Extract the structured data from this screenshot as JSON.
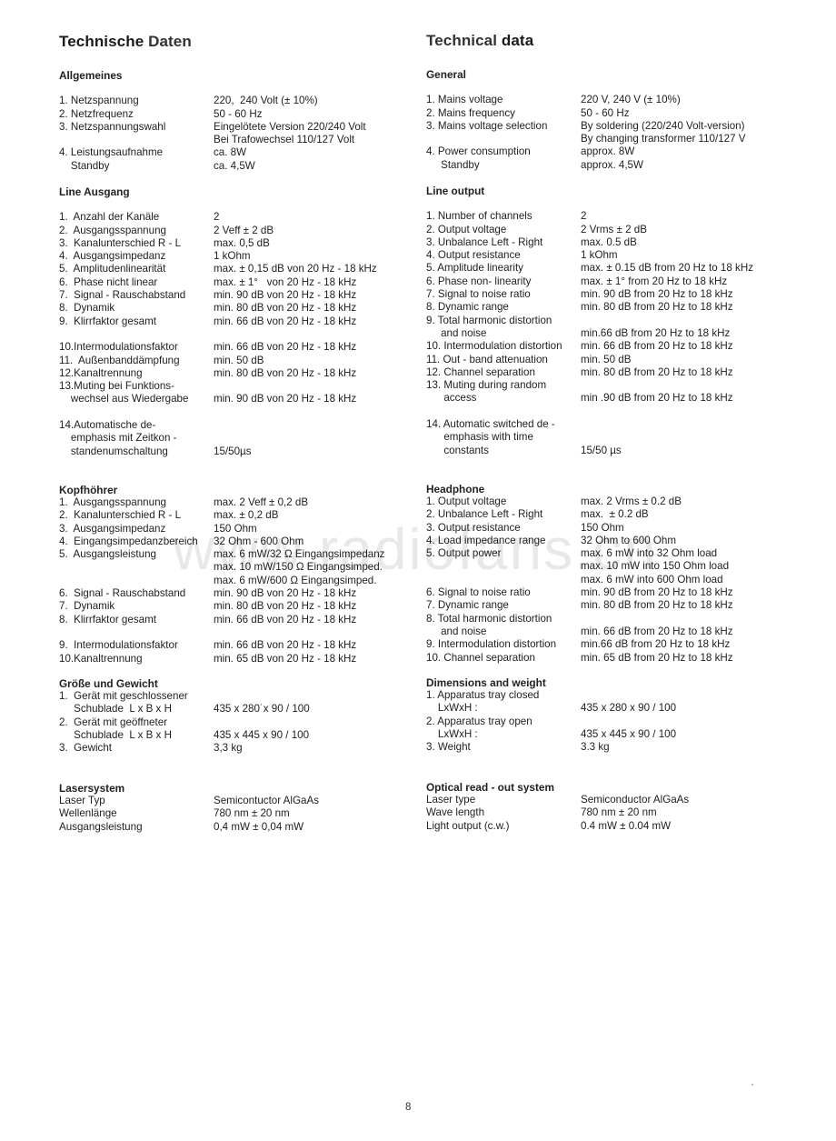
{
  "watermark": "www.radiofans.cn",
  "page_number": "8",
  "german": {
    "title_a": "Technische ",
    "title_b": "Daten",
    "general": {
      "title": "Allgemeines",
      "rows": [
        {
          "label": "1. Netzspannung",
          "value": "220,  240 Volt (± 10%)"
        },
        {
          "label": "2. Netzfrequenz",
          "value": "50 - 60 Hz"
        },
        {
          "label": "3. Netzspannungswahl",
          "value": "Eingelötete Version 220/240 Volt"
        },
        {
          "label": "",
          "value": "Bei Trafowechsel 110/127 Volt"
        },
        {
          "label": "4. Leistungsaufnahme",
          "value": "ca. 8W"
        },
        {
          "label": "    Standby",
          "value": "ca. 4,5W"
        }
      ]
    },
    "line": {
      "title": "Line Ausgang",
      "rows": [
        {
          "label": "1.  Anzahl der Kanäle",
          "value": "2"
        },
        {
          "label": "2.  Ausgangsspannung",
          "value": "2 Veff ± 2 dB"
        },
        {
          "label": "3.  Kanalunterschied R - L",
          "value": "max. 0,5 dB"
        },
        {
          "label": "4.  Ausgangsimpedanz",
          "value": "1 kOhm"
        },
        {
          "label": "5.  Amplitudenlinearität",
          "value": "max. ± 0,15 dB von 20 Hz - 18 kHz"
        },
        {
          "label": "6.  Phase nicht linear",
          "value": "max. ± 1°   von 20 Hz - 18 kHz"
        },
        {
          "label": "7.  Signal - Rauschabstand",
          "value": "min. 90 dB von 20 Hz - 18 kHz"
        },
        {
          "label": "8.  Dynamik",
          "value": "min. 80 dB von 20 Hz - 18 kHz"
        },
        {
          "label": "9.  Klirrfaktor gesamt",
          "value": "min. 66 dB von 20 Hz - 18 kHz"
        },
        {
          "label": "",
          "value": ""
        },
        {
          "label": "10.Intermodulationsfaktor",
          "value": "min. 66 dB von 20 Hz - 18 kHz"
        },
        {
          "label": "11.  Außenbanddämpfung",
          "value": "min. 50 dB"
        },
        {
          "label": "12.Kanaltrennung",
          "value": "min. 80 dB von 20 Hz - 18 kHz"
        },
        {
          "label": "13.Muting bei Funktions-",
          "value": ""
        },
        {
          "label": "    wechsel aus Wiedergabe",
          "value": "min. 90 dB von 20 Hz - 18 kHz"
        },
        {
          "label": "",
          "value": ""
        },
        {
          "label": "14.Automatische de-",
          "value": ""
        },
        {
          "label": "    emphasis mit Zeitkon -",
          "value": ""
        },
        {
          "label": "    standenumschaltung",
          "value": "15/50µs"
        }
      ]
    },
    "headphone": {
      "title": "Kopfhöhrer",
      "rows": [
        {
          "label": "1.  Ausgangsspannung",
          "value": "max. 2 Veff ± 0,2 dB"
        },
        {
          "label": "2.  Kanalunterschied R - L",
          "value": "max. ± 0,2 dB"
        },
        {
          "label": "3.  Ausgangsimpedanz",
          "value": "150 Ohm"
        },
        {
          "label": "4.  Eingangsimpedanzbereich",
          "value": "32 Ohm - 600 Ohm"
        },
        {
          "label": "5.  Ausgangsleistung",
          "value": "max. 6 mW/32 Ω Eingangsimpedanz"
        },
        {
          "label": "",
          "value": "max. 10 mW/150 Ω Eingangsimped."
        },
        {
          "label": "",
          "value": "max. 6 mW/600 Ω Eingangsimped."
        },
        {
          "label": "6.  Signal - Rauschabstand",
          "value": "min. 90 dB von 20 Hz - 18 kHz"
        },
        {
          "label": "7.  Dynamik",
          "value": "min. 80 dB von 20 Hz - 18 kHz"
        },
        {
          "label": "8.  Klirrfaktor gesamt",
          "value": "min. 66 dB von 20 Hz - 18 kHz"
        },
        {
          "label": "",
          "value": ""
        },
        {
          "label": "9.  Intermodulationsfaktor",
          "value": "min. 66 dB von 20 Hz - 18 kHz"
        },
        {
          "label": "10.Kanaltrennung",
          "value": "min. 65 dB von 20 Hz - 18 kHz"
        }
      ]
    },
    "dimensions": {
      "title": "Größe und Gewicht",
      "rows": [
        {
          "label": "1.  Gerät mit geschlossener",
          "value": ""
        },
        {
          "label": "     Schublade  L x B x H",
          "value": "435 x 280˙x 90 / 100"
        },
        {
          "label": "2.  Gerät mit geöffneter",
          "value": ""
        },
        {
          "label": "     Schublade  L x B x H",
          "value": "435 x 445 x 90 / 100"
        },
        {
          "label": "3.  Gewicht",
          "value": "3,3 kg"
        }
      ]
    },
    "laser": {
      "title": "Lasersystem",
      "rows": [
        {
          "label": "Laser Typ",
          "value": "Semicontuctor AlGaAs"
        },
        {
          "label": "Wellenlänge",
          "value": "780 nm ± 20 nm"
        },
        {
          "label": "Ausgangsleistung",
          "value": "0,4 mW ± 0,04 mW"
        }
      ]
    }
  },
  "english": {
    "title_a": "Technical ",
    "title_b": "data",
    "general": {
      "title": "General",
      "rows": [
        {
          "label": "1. Mains voltage",
          "value": "220 V, 240 V (± 10%)"
        },
        {
          "label": "2. Mains frequency",
          "value": "50 - 60 Hz"
        },
        {
          "label": "3. Mains voltage selection",
          "value": "By soldering (220/240 Volt-version)"
        },
        {
          "label": "",
          "value": "By changing transformer 110/127 V"
        },
        {
          "label": "4. Power consumption",
          "value": "approx. 8W"
        },
        {
          "label": "     Standby",
          "value": "approx. 4,5W"
        }
      ]
    },
    "line": {
      "title": "Line output",
      "rows": [
        {
          "label": "1. Number of channels",
          "value": "2"
        },
        {
          "label": "2. Output voltage",
          "value": "2 Vrms ± 2 dB"
        },
        {
          "label": "3. Unbalance Left - Right",
          "value": "max. 0.5 dB"
        },
        {
          "label": "4. Output resistance",
          "value": "1 kOhm"
        },
        {
          "label": "5. Amplitude linearity",
          "value": "max. ± 0.15 dB from 20 Hz to 18 kHz"
        },
        {
          "label": "6. Phase non- linearity",
          "value": "max. ± 1° from 20 Hz to 18 kHz"
        },
        {
          "label": "7. Signal to noise ratio",
          "value": "min. 90 dB from 20 Hz to 18 kHz"
        },
        {
          "label": "8. Dynamic range",
          "value": "min. 80 dB from 20 Hz to 18 kHz"
        },
        {
          "label": "9. Total harmonic distortion",
          "value": ""
        },
        {
          "label": "     and noise",
          "value": "min.66 dB from 20 Hz to 18 kHz"
        },
        {
          "label": "10. Intermodulation distortion",
          "value": "min. 66 dB from 20 Hz to 18 kHz"
        },
        {
          "label": "11. Out - band attenuation",
          "value": "min. 50 dB"
        },
        {
          "label": "12. Channel separation",
          "value": "min. 80 dB from 20 Hz to 18 kHz"
        },
        {
          "label": "13. Muting during random",
          "value": ""
        },
        {
          "label": "      access",
          "value": "min .90 dB from 20 Hz to 18 kHz"
        },
        {
          "label": "",
          "value": ""
        },
        {
          "label": "14. Automatic switched de -",
          "value": ""
        },
        {
          "label": "      emphasis with time",
          "value": ""
        },
        {
          "label": "      constants",
          "value": "15/50 µs"
        }
      ]
    },
    "headphone": {
      "title": "Headphone",
      "rows": [
        {
          "label": "1. Output voltage",
          "value": "max. 2 Vrms ± 0.2 dB"
        },
        {
          "label": "2. Unbalance Left - Right",
          "value": "max.  ± 0.2 dB"
        },
        {
          "label": "3. Output resistance",
          "value": "150 Ohm"
        },
        {
          "label": "4. Load impedance range",
          "value": "32 Ohm to 600 Ohm"
        },
        {
          "label": "5. Output power",
          "value": "max. 6 mW into 32 Ohm load"
        },
        {
          "label": "",
          "value": "max. 10 mW into 150 Ohm load"
        },
        {
          "label": "",
          "value": "max. 6 mW into 600 Ohm load"
        },
        {
          "label": "6. Signal to noise ratio",
          "value": "min. 90 dB from 20 Hz to 18 kHz"
        },
        {
          "label": "7. Dynamic range",
          "value": "min. 80 dB from 20 Hz to 18 kHz"
        },
        {
          "label": "8. Total harmonic distortion",
          "value": ""
        },
        {
          "label": "     and noise",
          "value": "min. 66 dB from 20 Hz to 18 kHz"
        },
        {
          "label": "9. Intermodulation distortion",
          "value": "min.66 dB from 20 Hz to 18 kHz"
        },
        {
          "label": "10. Channel separation",
          "value": "min. 65 dB from 20 Hz to 18 kHz"
        }
      ]
    },
    "dimensions": {
      "title": "Dimensions and weight",
      "rows": [
        {
          "label": "1. Apparatus tray closed",
          "value": ""
        },
        {
          "label": "    LxWxH :",
          "value": "435 x 280 x 90 / 100"
        },
        {
          "label": "2. Apparatus tray open",
          "value": ""
        },
        {
          "label": "    LxWxH :",
          "value": "435 x 445 x 90 / 100"
        },
        {
          "label": "3. Weight",
          "value": "3.3 kg"
        }
      ]
    },
    "laser": {
      "title": "Optical read - out system",
      "rows": [
        {
          "label": "Laser type",
          "value": "Semiconductor AlGaAs"
        },
        {
          "label": "Wave length",
          "value": "780 nm ± 20 nm"
        },
        {
          "label": "Light output (c.w.)",
          "value": "0.4 mW ± 0.04 mW"
        }
      ]
    }
  }
}
